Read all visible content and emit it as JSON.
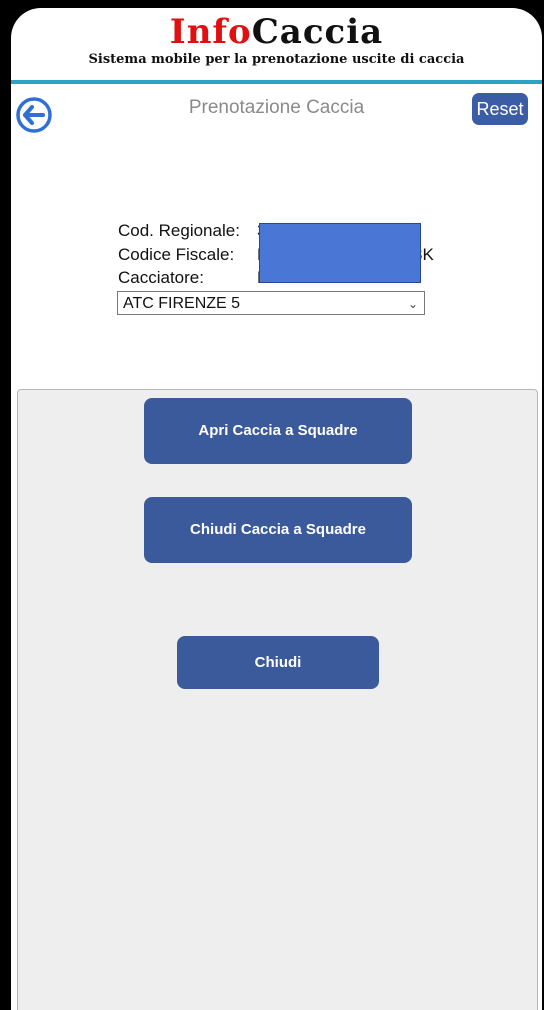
{
  "header": {
    "logo_part1": "Info",
    "logo_part2": "Caccia",
    "subtitle": "Sistema mobile per la prenotazione uscite di caccia"
  },
  "toolbar": {
    "title": "Prenotazione Caccia",
    "reset_label": "Reset",
    "back_icon": "arrow-left-circle-icon"
  },
  "info": {
    "cod_regionale_label": "Cod. Regionale:",
    "cod_regionale_value": "3",
    "codice_fiscale_label": "Codice Fiscale:",
    "codice_fiscale_value_prefix": "M",
    "codice_fiscale_value_suffix": "3K",
    "cacciatore_label": "Cacciatore:",
    "cacciatore_value": "M"
  },
  "atc_select": {
    "selected": "ATC FIRENZE 5"
  },
  "actions": {
    "open_label": "Apri Caccia a Squadre",
    "close_squad_label": "Chiudi Caccia a Squadre",
    "close_label": "Chiudi"
  },
  "colors": {
    "accent": "#3b5a9c",
    "header_line": "#2aa3c7",
    "logo_red": "#e01010"
  }
}
